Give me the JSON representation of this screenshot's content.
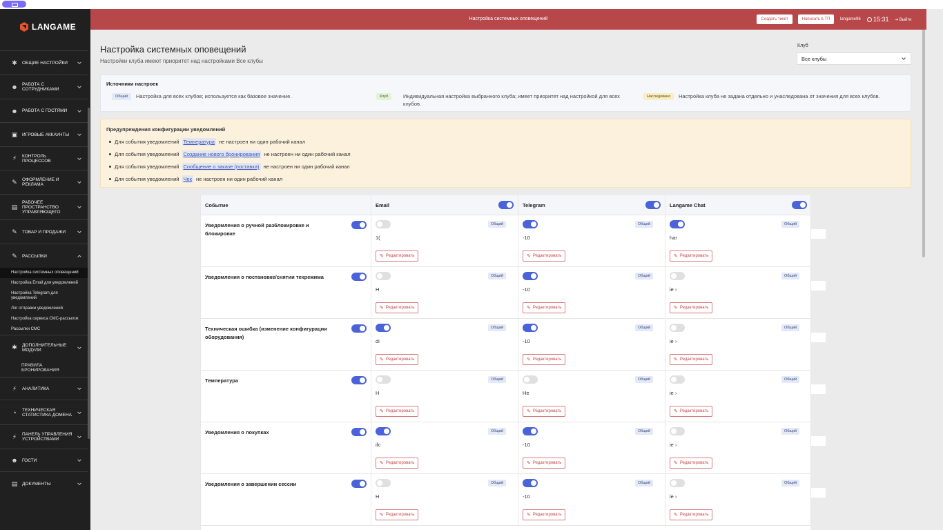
{
  "app": {
    "logo_text": "LANGAME"
  },
  "header": {
    "title": "Настройка системных оповещений",
    "create_ticket": "Создать тикет",
    "write_support": "Написать в ТП",
    "user": "langame96",
    "time": "15:31",
    "logout": "Выйти"
  },
  "sidebar": {
    "items": [
      {
        "label": "Общие настройки",
        "icon": "gear-icon"
      },
      {
        "label": "Работа с сотрудниками",
        "icon": "users-icon"
      },
      {
        "label": "Работа с гостями",
        "icon": "users-icon"
      },
      {
        "label": "Игровые аккаунты",
        "icon": "account-icon"
      },
      {
        "label": "Контроль процессов",
        "icon": "bolt-icon"
      },
      {
        "label": "Оформление и реклама",
        "icon": "edit-icon"
      },
      {
        "label": "Рабочее пространство управляющего",
        "icon": "briefcase-icon"
      },
      {
        "label": "Товар и продажи",
        "icon": "edit-icon"
      },
      {
        "label": "Рассылки",
        "icon": "edit-icon"
      }
    ],
    "sub_items": [
      "Настройка системных оповещений",
      "Настройка Email для уведомлений",
      "Настройка Telegram для уведомлений",
      "Лог отправки уведомлений",
      "Настройка сервиса СМС-рассылок",
      "Рассылки СМС"
    ],
    "items2": [
      {
        "label": "Дополнительные модули",
        "icon": "gear-icon"
      }
    ],
    "extra_sub": "Правила бронирования",
    "items3": [
      {
        "label": "Аналитика",
        "icon": "bolt-icon"
      },
      {
        "label": "Техническая статистика домена",
        "icon": "pie-icon"
      },
      {
        "label": "Панель управления устройствами",
        "icon": "bolt-icon"
      },
      {
        "label": "Гости",
        "icon": "users-icon"
      },
      {
        "label": "Документы",
        "icon": "doc-icon"
      }
    ]
  },
  "page": {
    "title": "Настройка системных оповещений",
    "subtitle": "Настройки клуба имеют приоритет над настройками Все клубы",
    "club_label": "Клуб",
    "club_value": "Все клубы"
  },
  "sources": {
    "title": "Источники настроек",
    "common_badge": "Общий",
    "common_text": "Настройка для всех клубов; используется как базовое значение.",
    "club_badge": "Клуб",
    "club_text": "Индивидуальная настройка выбранного клуба; имеет приоритет над настройкой для всех клубов.",
    "inherit_badge": "Наследовано",
    "inherit_text": "Настройка клуба не задана отдельно и унаследована от значения для всех клубов."
  },
  "warnings": {
    "title": "Предупреждения конфигурации уведомлений",
    "prefix": "Для события уведомлений",
    "suffix": "не настроен ни один рабочий канал",
    "events": [
      "Температура",
      "Создание нового бронирования",
      "Сообщение о заказе (поставка)",
      "Чек"
    ]
  },
  "table": {
    "col_event": "Событие",
    "col_email": "Email",
    "col_telegram": "Telegram",
    "col_chat": "Langame Chat",
    "header_toggles": {
      "email": true,
      "telegram": true,
      "chat": true
    },
    "edit_label": "Редактировать",
    "badge": "Общий",
    "rows": [
      {
        "name": "Уведомления о ручной разблокировке и блокировке",
        "enabled": true,
        "email": {
          "on": false,
          "value": "1("
        },
        "telegram": {
          "on": true,
          "value": "-10"
        },
        "chat": {
          "on": true,
          "value": "har"
        }
      },
      {
        "name": "Уведомления о постановке/снятии техрежима",
        "enabled": true,
        "email": {
          "on": false,
          "value": "Н"
        },
        "telegram": {
          "on": true,
          "value": "-10"
        },
        "chat": {
          "on": false,
          "value": "іе ›"
        }
      },
      {
        "name": "Техническая ошибка (изменение конфигурации оборудования)",
        "enabled": true,
        "email": {
          "on": true,
          "value": "di"
        },
        "telegram": {
          "on": true,
          "value": "-10"
        },
        "chat": {
          "on": false,
          "value": "іе ›"
        }
      },
      {
        "name": "Температура",
        "enabled": true,
        "email": {
          "on": false,
          "value": "Н"
        },
        "telegram": {
          "on": false,
          "value": "Не"
        },
        "chat": {
          "on": false,
          "value": "іе ›"
        }
      },
      {
        "name": "Уведомления о покупках",
        "enabled": true,
        "email": {
          "on": true,
          "value": "ifc"
        },
        "telegram": {
          "on": true,
          "value": "-10"
        },
        "chat": {
          "on": false,
          "value": "іе ›"
        }
      },
      {
        "name": "Уведомления о завершении сессии",
        "enabled": true,
        "email": {
          "on": false,
          "value": "Н"
        },
        "telegram": {
          "on": true,
          "value": "-10"
        },
        "chat": {
          "on": false,
          "value": "іе ›"
        }
      }
    ]
  }
}
